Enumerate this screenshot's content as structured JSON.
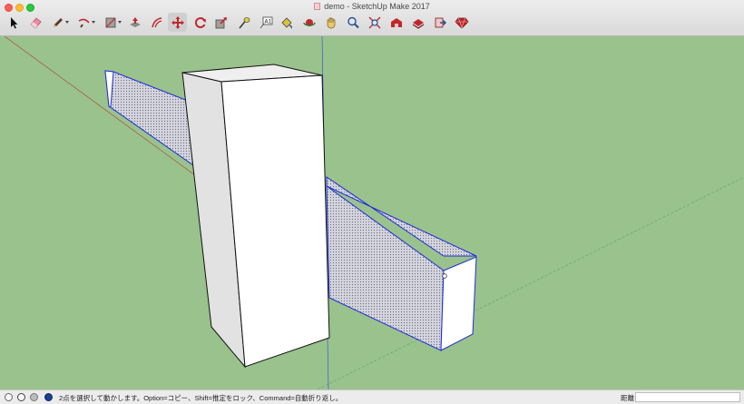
{
  "window": {
    "title": "demo - SketchUp Make 2017",
    "buttons": [
      "close",
      "minimize",
      "zoom"
    ]
  },
  "toolbar": {
    "tools": [
      {
        "name": "select-tool",
        "icon": "arrow-cursor-icon"
      },
      {
        "name": "eraser-tool",
        "icon": "eraser-icon"
      },
      {
        "name": "line-tool",
        "icon": "pencil-icon",
        "dropdown": true
      },
      {
        "name": "arc-tool",
        "icon": "arc-icon",
        "dropdown": true
      },
      {
        "name": "rectangle-tool",
        "icon": "rectangle-icon",
        "dropdown": true
      },
      {
        "name": "push-pull-tool",
        "icon": "push-pull-icon"
      },
      {
        "name": "offset-tool",
        "icon": "offset-icon"
      },
      {
        "name": "move-tool",
        "icon": "move-arrows-icon",
        "active": true
      },
      {
        "name": "rotate-tool",
        "icon": "rotate-icon"
      },
      {
        "name": "scale-tool",
        "icon": "scale-icon"
      },
      {
        "name": "tape-measure-tool",
        "icon": "tape-measure-icon"
      },
      {
        "name": "text-tool",
        "icon": "text-icon"
      },
      {
        "name": "paint-bucket-tool",
        "icon": "paint-bucket-icon"
      },
      {
        "name": "orbit-tool",
        "icon": "orbit-icon"
      },
      {
        "name": "pan-tool",
        "icon": "hand-icon"
      },
      {
        "name": "zoom-tool",
        "icon": "magnifier-icon"
      },
      {
        "name": "zoom-extents-tool",
        "icon": "zoom-extents-icon"
      },
      {
        "name": "3d-warehouse-tool",
        "icon": "warehouse-icon"
      },
      {
        "name": "share-model-tool",
        "icon": "share-model-icon"
      },
      {
        "name": "extension-warehouse-tool",
        "icon": "extension-icon"
      },
      {
        "name": "extension-manager-tool",
        "icon": "ruby-gem-icon"
      }
    ]
  },
  "colors": {
    "ground": "#9ac28c",
    "selection_edge": "#1f2bd8",
    "face_white": "#ffffff",
    "face_shade": "#e2e2e2",
    "axis_red": "#a85040",
    "axis_blue": "#3a58d8",
    "axis_green": "#5aa85a"
  },
  "status": {
    "message": "2点を選択して動かします。Option=コピー、Shift=推定をロック、Command=自動折り返し。",
    "measure_label": "距離",
    "measure_value": ""
  }
}
